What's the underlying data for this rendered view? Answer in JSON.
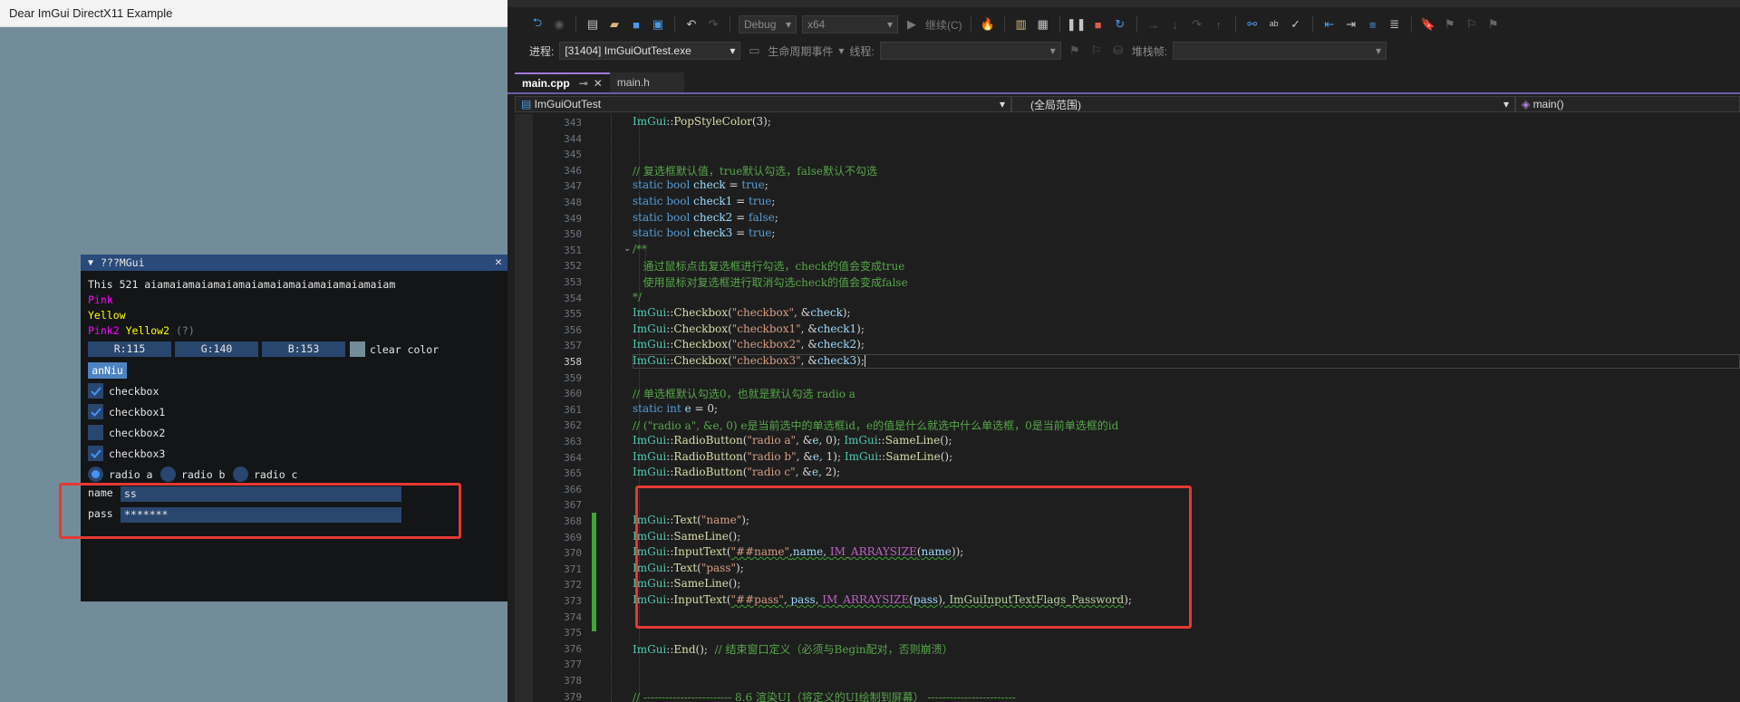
{
  "host": {
    "title": "Dear ImGui DirectX11 Example",
    "bg_color": "#738c99"
  },
  "imgui": {
    "window_title": "???MGui",
    "collapse_icon": "triangle-down-icon",
    "close_icon": "close-icon",
    "line1": "This 521 aiamaiamaiamaiamaiamaiamaiamaiamaiamaiam",
    "pink": "Pink",
    "yellow": "Yellow",
    "pink2": "Pink2",
    "yellow2": "Yellow2",
    "help": "(?)",
    "r": "R:115",
    "g": "G:140",
    "b": "B:153",
    "clear_color": "clear color",
    "button": "anNiu",
    "checkboxes": [
      {
        "label": "checkbox",
        "checked": true
      },
      {
        "label": "checkbox1",
        "checked": true
      },
      {
        "label": "checkbox2",
        "checked": false
      },
      {
        "label": "checkbox3",
        "checked": true
      }
    ],
    "radios": [
      "radio a",
      "radio b",
      "radio c"
    ],
    "radio_selected": 0,
    "name_label": "name",
    "name_value": "ss",
    "pass_label": "pass",
    "pass_value": "*******"
  },
  "vs": {
    "configuration": "Debug",
    "platform": "x64",
    "continue_label": "继续(C)",
    "process_label": "进程:",
    "process_value": "[31404] ImGuiOutTest.exe",
    "lifecycle_label": "生命周期事件",
    "thread_label": "线程:",
    "stackframe_label": "堆栈帧:",
    "tabs": [
      "main.cpp",
      "main.h"
    ],
    "nav_project": "ImGuiOutTest",
    "nav_scope": "(全局范围)",
    "nav_member": "main()",
    "current_line": "358"
  },
  "code_lines": [
    {
      "n": "343",
      "html": "<span class=\"ns\">ImGui</span>::<span class=\"f\">PopStyleColor</span>(3);"
    },
    {
      "n": "344",
      "html": ""
    },
    {
      "n": "345",
      "html": ""
    },
    {
      "n": "346",
      "html": "<span class=\"cm\">// 复选框默认值，true默认勾选，false默认不勾选</span>"
    },
    {
      "n": "347",
      "html": "<span class=\"k\">static</span> <span class=\"k\">bool</span> <span class=\"v\">check</span> = <span class=\"k\">true</span>;"
    },
    {
      "n": "348",
      "html": "<span class=\"k\">static</span> <span class=\"k\">bool</span> <span class=\"v\">check1</span> = <span class=\"k\">true</span>;"
    },
    {
      "n": "349",
      "html": "<span class=\"k\">static</span> <span class=\"k\">bool</span> <span class=\"v\">check2</span> = <span class=\"k\">false</span>;"
    },
    {
      "n": "350",
      "html": "<span class=\"k\">static</span> <span class=\"k\">bool</span> <span class=\"v\">check3</span> = <span class=\"k\">true</span>;"
    },
    {
      "n": "351",
      "html": "<span class=\"cm\">/**</span>"
    },
    {
      "n": "352",
      "html": "<span class=\"cm\">   通过鼠标点击复选框进行勾选，check的值会变成true</span>"
    },
    {
      "n": "353",
      "html": "<span class=\"cm\">   使用鼠标对复选框进行取消勾选check的值会变成false</span>"
    },
    {
      "n": "354",
      "html": "<span class=\"cm\">*/</span>"
    },
    {
      "n": "355",
      "html": "<span class=\"ns\">ImGui</span>::<span class=\"f\">Checkbox</span>(<span class=\"s\">\"checkbox\"</span>, &amp;<span class=\"v\">check</span>);"
    },
    {
      "n": "356",
      "html": "<span class=\"ns\">ImGui</span>::<span class=\"f\">Checkbox</span>(<span class=\"s\">\"checkbox1\"</span>, &amp;<span class=\"v\">check1</span>);"
    },
    {
      "n": "357",
      "html": "<span class=\"ns\">ImGui</span>::<span class=\"f\">Checkbox</span>(<span class=\"s\">\"checkbox2\"</span>, &amp;<span class=\"v\">check2</span>);"
    },
    {
      "n": "358",
      "html": "<span class=\"ns\">ImGui</span>::<span class=\"f\">Checkbox</span>(<span class=\"s\">\"checkbox3\"</span>, &amp;<span class=\"v\">check3</span>);<span class=\"caret\"></span>"
    },
    {
      "n": "359",
      "html": ""
    },
    {
      "n": "360",
      "html": "<span class=\"cm\">// 单选框默认勾选0，也就是默认勾选 radio a</span>"
    },
    {
      "n": "361",
      "html": "<span class=\"k\">static</span> <span class=\"k\">int</span> <span class=\"v\">e</span> = 0;"
    },
    {
      "n": "362",
      "html": "<span class=\"cm\">// (\"radio a\", &amp;e, 0) e是当前选中的单选框id，e的值是什么就选中什么单选框，0是当前单选框的id</span>"
    },
    {
      "n": "363",
      "html": "<span class=\"ns\">ImGui</span>::<span class=\"f\">RadioButton</span>(<span class=\"s\">\"radio a\"</span>, &amp;<span class=\"v\">e</span>, 0); <span class=\"ns\">ImGui</span>::<span class=\"f\">SameLine</span>();"
    },
    {
      "n": "364",
      "html": "<span class=\"ns\">ImGui</span>::<span class=\"f\">RadioButton</span>(<span class=\"s\">\"radio b\"</span>, &amp;<span class=\"v\">e</span>, 1); <span class=\"ns\">ImGui</span>::<span class=\"f\">SameLine</span>();"
    },
    {
      "n": "365",
      "html": "<span class=\"ns\">ImGui</span>::<span class=\"f\">RadioButton</span>(<span class=\"s\">\"radio c\"</span>, &amp;<span class=\"v\">e</span>, 2);"
    },
    {
      "n": "366",
      "html": ""
    },
    {
      "n": "367",
      "html": ""
    },
    {
      "n": "368",
      "html": "<span class=\"ns\">ImGui</span>::<span class=\"f\">Text</span>(<span class=\"s\">\"name\"</span>);"
    },
    {
      "n": "369",
      "html": "<span class=\"ns\">ImGui</span>::<span class=\"f\">SameLine</span>();"
    },
    {
      "n": "370",
      "html": "<span class=\"ns\">ImGui</span>::<span class=\"f\">InputText</span>(<span class=\"squig\"><span class=\"s\">\"##name\"</span>,<span class=\"v\">name</span>, <span class=\"mac\">IM_ARRAYSIZE</span>(<span class=\"v\">name</span>)</span>);"
    },
    {
      "n": "371",
      "html": "<span class=\"ns\">ImGui</span>::<span class=\"f\">Text</span>(<span class=\"s\">\"pass\"</span>);"
    },
    {
      "n": "372",
      "html": "<span class=\"ns\">ImGui</span>::<span class=\"f\">SameLine</span>();"
    },
    {
      "n": "373",
      "html": "<span class=\"ns\">ImGui</span>::<span class=\"f\">InputText</span>(<span class=\"squig\"><span class=\"s\">\"##pass\"</span>, <span class=\"v\">pass</span>, <span class=\"mac\">IM_ARRAYSIZE</span>(<span class=\"v\">pass</span>), <span class=\"en\">ImGuiInputTextFlags_Password</span></span>);"
    },
    {
      "n": "374",
      "html": ""
    },
    {
      "n": "375",
      "html": ""
    },
    {
      "n": "376",
      "html": "<span class=\"ns\">ImGui</span>::<span class=\"f\">End</span>();  <span class=\"cm\">// 结束窗口定义（必须与Begin配对，否则崩溃）</span>"
    },
    {
      "n": "377",
      "html": ""
    },
    {
      "n": "378",
      "html": ""
    },
    {
      "n": "379",
      "html": "<span class=\"cm\">// ------------------------ 8.6 渲染UI（将定义的UI绘制到屏幕） ------------------------</span>"
    }
  ]
}
